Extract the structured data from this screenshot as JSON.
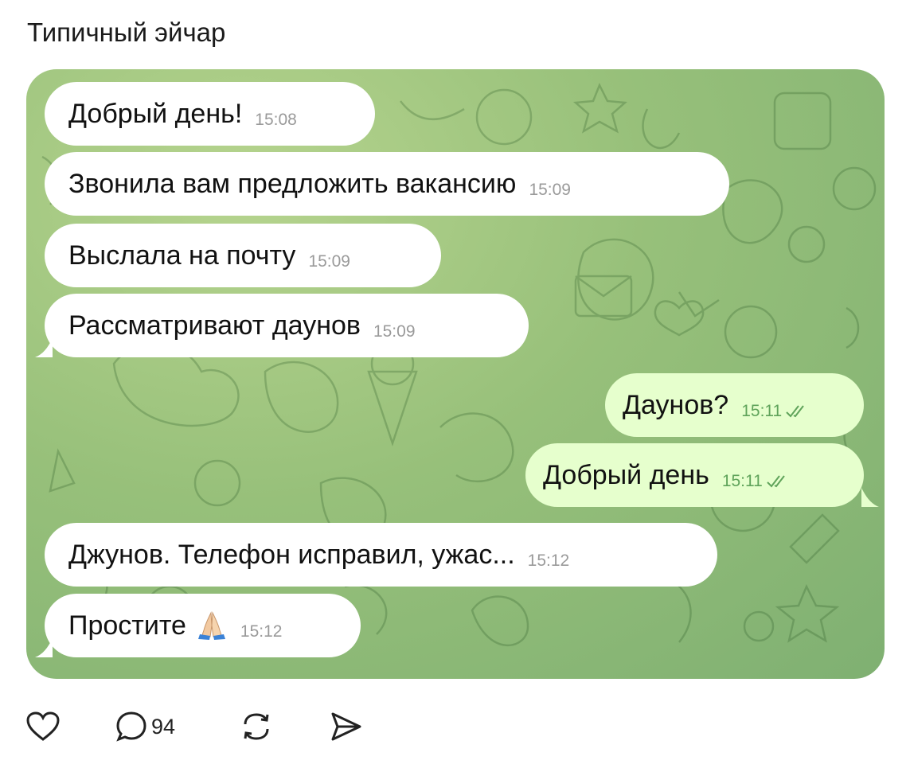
{
  "post": {
    "author": "Типичный эйчар"
  },
  "messages": [
    {
      "text": "Добрый день!",
      "time": "15:08",
      "direction": "incoming"
    },
    {
      "text": "Звонила вам предложить вакансию",
      "time": "15:09",
      "direction": "incoming"
    },
    {
      "text": "Выслала на почту",
      "time": "15:09",
      "direction": "incoming"
    },
    {
      "text": "Рассматривают даунов",
      "time": "15:09",
      "direction": "incoming"
    },
    {
      "text": "Даунов?",
      "time": "15:11",
      "direction": "outgoing",
      "status": "read"
    },
    {
      "text": "Добрый день",
      "time": "15:11",
      "direction": "outgoing",
      "status": "read"
    },
    {
      "text": "Джунов. Телефон исправил, ужас...",
      "time": "15:12",
      "direction": "incoming"
    },
    {
      "text": "Простите",
      "time": "15:12",
      "direction": "incoming",
      "emoji": "folded-hands"
    }
  ],
  "actions": {
    "like_icon": "heart-icon",
    "comment_icon": "comment-icon",
    "comment_count": "94",
    "repost_icon": "repost-icon",
    "share_icon": "share-icon"
  },
  "colors": {
    "incoming_bubble": "#ffffff",
    "outgoing_bubble": "#e6ffcd",
    "chat_background": "#97c07a",
    "read_checks": "#5fa35a"
  }
}
